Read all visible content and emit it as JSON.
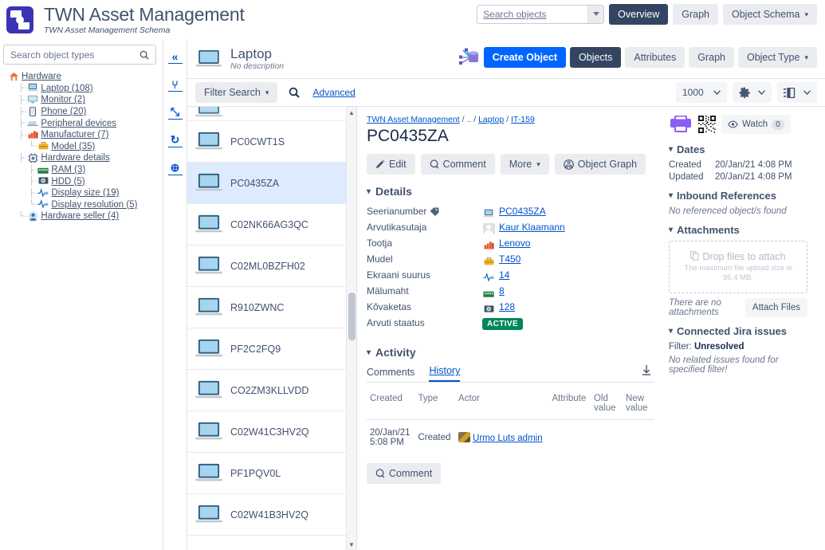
{
  "topbar": {
    "app_title": "TWN Asset Management",
    "app_subtitle": "TWN Asset Management Schema",
    "search_placeholder": "Search objects",
    "btn_overview": "Overview",
    "btn_graph": "Graph",
    "btn_object_schema": "Object Schema"
  },
  "type_panel": {
    "search_placeholder": "Search object types",
    "tree": [
      {
        "label": "Hardware",
        "icon": "home-icon",
        "depth": 0,
        "selected": false
      },
      {
        "label": "Laptop (108)",
        "icon": "laptop-icon",
        "depth": 1,
        "selected": true
      },
      {
        "label": "Monitor (2)",
        "icon": "monitor-icon",
        "depth": 1,
        "selected": false
      },
      {
        "label": "Phone (20)",
        "icon": "phone-icon",
        "depth": 1,
        "selected": false
      },
      {
        "label": "Peripheral devices",
        "icon": "keyboard-icon",
        "depth": 1,
        "selected": false
      },
      {
        "label": "Manufacturer (7)",
        "icon": "factory-icon",
        "depth": 1,
        "selected": false
      },
      {
        "label": "Model (35)",
        "icon": "briefcase-icon",
        "depth": 2,
        "selected": false
      },
      {
        "label": "Hardware details",
        "icon": "chip-icon",
        "depth": 1,
        "selected": false
      },
      {
        "label": "RAM (3)",
        "icon": "ram-icon",
        "depth": 2,
        "selected": false
      },
      {
        "label": "HDD (5)",
        "icon": "hdd-icon",
        "depth": 2,
        "selected": false
      },
      {
        "label": "Display size (19)",
        "icon": "pulse-icon",
        "depth": 2,
        "selected": false
      },
      {
        "label": "Display resolution (5)",
        "icon": "pulse-icon",
        "depth": 2,
        "selected": false
      },
      {
        "label": "Hardware seller (4)",
        "icon": "person-icon",
        "depth": 1,
        "selected": false
      }
    ]
  },
  "icon_strip": [
    {
      "name": "collapse-panel-icon",
      "glyph": "«"
    },
    {
      "name": "tree-view-icon",
      "glyph": "⑂"
    },
    {
      "name": "expand-icon",
      "glyph": "⤡"
    },
    {
      "name": "refresh-icon",
      "glyph": "↻"
    },
    {
      "name": "add-object-type-icon",
      "glyph": "⊕"
    }
  ],
  "object_type_header": {
    "title": "Laptop",
    "subtitle": "No description",
    "btn_create_object": "Create Object",
    "tab_objects": "Objects",
    "tab_attributes": "Attributes",
    "tab_graph": "Graph",
    "btn_object_type": "Object Type"
  },
  "filter_bar": {
    "filter_search": "Filter Search",
    "advanced": "Advanced",
    "page_size": "1000",
    "settings_icon": "gear-icon",
    "columns_icon": "columns-icon"
  },
  "object_list": {
    "items": [
      {
        "name": "",
        "selected": false,
        "clipped": true
      },
      {
        "name": "PC0CWT1S",
        "selected": false,
        "clipped": false
      },
      {
        "name": "PC0435ZA",
        "selected": true,
        "clipped": false
      },
      {
        "name": "C02NK66AG3QC",
        "selected": false,
        "clipped": false
      },
      {
        "name": "C02ML0BZFH02",
        "selected": false,
        "clipped": false
      },
      {
        "name": "R910ZWNC",
        "selected": false,
        "clipped": false
      },
      {
        "name": "PF2C2FQ9",
        "selected": false,
        "clipped": false
      },
      {
        "name": "CO2ZM3KLLVDD",
        "selected": false,
        "clipped": false
      },
      {
        "name": "C02W41C3HV2Q",
        "selected": false,
        "clipped": false
      },
      {
        "name": "PF1PQV0L",
        "selected": false,
        "clipped": false
      },
      {
        "name": "C02W41B3HV2Q",
        "selected": false,
        "clipped": false
      }
    ]
  },
  "detail": {
    "breadcrumb": [
      {
        "label": "TWN Asset Management",
        "link": true
      },
      {
        "label": "..",
        "link": false
      },
      {
        "label": "Laptop",
        "link": true
      },
      {
        "label": "IT-159",
        "link": true
      }
    ],
    "object_name": "PC0435ZA",
    "actions": {
      "edit": "Edit",
      "comment": "Comment",
      "more": "More",
      "object_graph": "Object Graph"
    },
    "details_heading": "Details",
    "attributes": [
      {
        "key": "Seerianumber",
        "key_icon": "label-icon",
        "value": "PC0435ZA",
        "value_icon": "laptop-icon",
        "link": true
      },
      {
        "key": "Arvutikasutaja",
        "key_icon": "",
        "value": "Kaur Klaamann",
        "value_icon": "avatar-icon",
        "link": true
      },
      {
        "key": "Tootja",
        "key_icon": "",
        "value": "Lenovo",
        "value_icon": "factory-icon",
        "link": true
      },
      {
        "key": "Mudel",
        "key_icon": "",
        "value": "T450",
        "value_icon": "briefcase-icon",
        "link": true
      },
      {
        "key": "Ekraani suurus",
        "key_icon": "",
        "value": "14",
        "value_icon": "pulse-icon",
        "link": true
      },
      {
        "key": "Mälumaht",
        "key_icon": "",
        "value": "8",
        "value_icon": "ram-icon",
        "link": true
      },
      {
        "key": "Kõvaketas",
        "key_icon": "",
        "value": "128",
        "value_icon": "hdd-icon",
        "link": true
      },
      {
        "key": "Arvuti staatus",
        "key_icon": "",
        "value": "ACTIVE",
        "value_icon": "",
        "link": false,
        "lozenge": true,
        "lozenge_color": "#00875a"
      }
    ],
    "activity_heading": "Activity",
    "activity_tabs": [
      {
        "label": "Comments",
        "active": false
      },
      {
        "label": "History",
        "active": true
      }
    ],
    "download_icon": "download-icon",
    "history_columns": [
      "Created",
      "Type",
      "Actor",
      "Attribute",
      "Old value",
      "New value"
    ],
    "history_rows": [
      {
        "created": "20/Jan/21 5:08 PM",
        "type": "Created",
        "actor": "Urmo Luts admin",
        "attribute": "",
        "old_value": "",
        "new_value": ""
      }
    ],
    "comment_button": "Comment"
  },
  "sidebar": {
    "print_icon": "printer-icon",
    "qr_icon": "qr-code-icon",
    "watch_label": "Watch",
    "watch_count": "0",
    "dates_heading": "Dates",
    "created_label": "Created",
    "created_value": "20/Jan/21 4:08 PM",
    "updated_label": "Updated",
    "updated_value": "20/Jan/21 4:08 PM",
    "inbound_heading": "Inbound References",
    "inbound_empty": "No referenced object/s found",
    "attachments_heading": "Attachments",
    "dropzone_title": "Drop files to attach",
    "dropzone_sub": "The maximum file upload size is 95.4 MB.",
    "attach_button": "Attach Files",
    "no_attachments": "There are no attachments",
    "jira_heading": "Connected Jira issues",
    "jira_filter_label": "Filter:",
    "jira_filter_value": "Unresolved",
    "jira_empty": "No related issues found for specified filter!"
  },
  "colors": {
    "accent_blue": "#0052cc",
    "brand_purple": "#3b35b5",
    "create_button": "#0065ff",
    "tab_active": "#344563",
    "status_green": "#00875a",
    "selection_blue": "#deebff"
  }
}
